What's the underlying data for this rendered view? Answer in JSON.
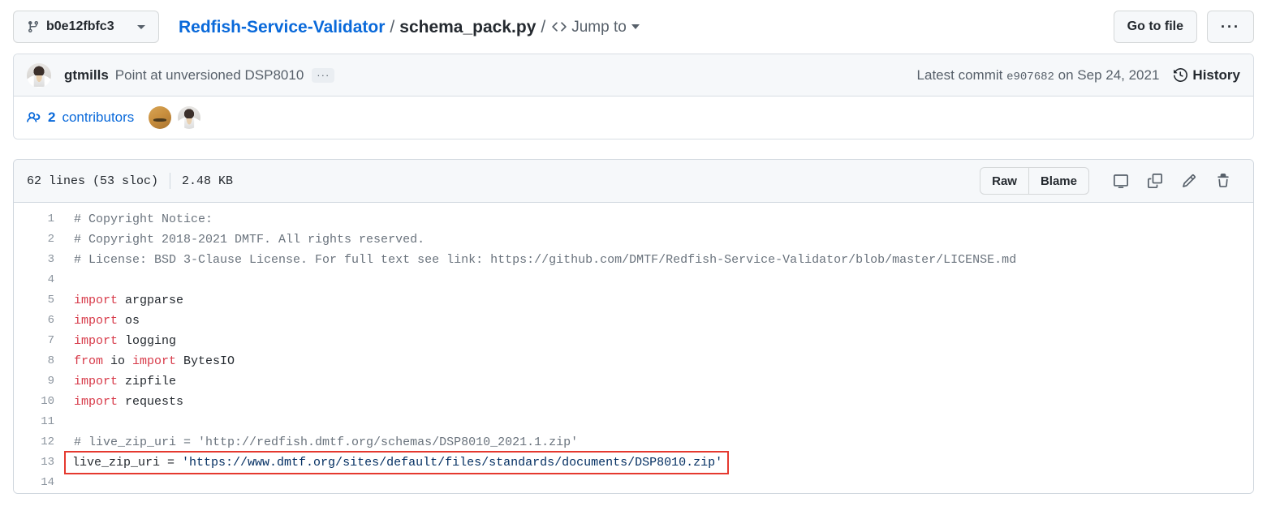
{
  "header": {
    "branch_label": "b0e12fbfc3",
    "branch_icon": "git-branch-icon",
    "repo_name": "Redfish-Service-Validator",
    "path_separator": "/",
    "file_name": "schema_pack.py",
    "jump_to_label": "Jump to",
    "jump_to_icon": "code-icon",
    "go_to_file_label": "Go to file",
    "more_options_label": "···"
  },
  "commit": {
    "author": "gtmills",
    "message": "Point at unversioned DSP8010",
    "expander_label": "···",
    "latest_commit_label": "Latest commit",
    "sha": "e907682",
    "date_label": "on Sep 24, 2021",
    "history_label": "History",
    "history_icon": "history-clock-icon",
    "contributors_count": "2",
    "contributors_label": "contributors",
    "contributors_icon": "people-icon",
    "avatars": [
      "sandy",
      "person"
    ]
  },
  "file_toolbar": {
    "lines_label": "62 lines (53 sloc)",
    "size_label": "2.48 KB",
    "raw_label": "Raw",
    "blame_label": "Blame",
    "icons": [
      "desktop-download-icon",
      "copy-icon",
      "pencil-edit-icon",
      "trash-delete-icon"
    ]
  },
  "annotation": {
    "color": "#e5392f",
    "target_line": 13
  },
  "code": {
    "language": "python",
    "lines": [
      {
        "n": "1",
        "tokens": [
          {
            "t": "# Copyright Notice:",
            "c": "cm"
          }
        ]
      },
      {
        "n": "2",
        "tokens": [
          {
            "t": "# Copyright 2018-2021 DMTF. All rights reserved.",
            "c": "cm"
          }
        ]
      },
      {
        "n": "3",
        "tokens": [
          {
            "t": "# License: BSD 3-Clause License. For full text see link: https://github.com/DMTF/Redfish-Service-Validator/blob/master/LICENSE.md",
            "c": "cm"
          }
        ]
      },
      {
        "n": "4",
        "tokens": []
      },
      {
        "n": "5",
        "tokens": [
          {
            "t": "import",
            "c": "kw"
          },
          {
            "t": " argparse",
            "c": "nm"
          }
        ]
      },
      {
        "n": "6",
        "tokens": [
          {
            "t": "import",
            "c": "kw"
          },
          {
            "t": " os",
            "c": "nm"
          }
        ]
      },
      {
        "n": "7",
        "tokens": [
          {
            "t": "import",
            "c": "kw"
          },
          {
            "t": " logging",
            "c": "nm"
          }
        ]
      },
      {
        "n": "8",
        "tokens": [
          {
            "t": "from",
            "c": "kw"
          },
          {
            "t": " io ",
            "c": "nm"
          },
          {
            "t": "import",
            "c": "kw"
          },
          {
            "t": " BytesIO",
            "c": "nm"
          }
        ]
      },
      {
        "n": "9",
        "tokens": [
          {
            "t": "import",
            "c": "kw"
          },
          {
            "t": " zipfile",
            "c": "nm"
          }
        ]
      },
      {
        "n": "10",
        "tokens": [
          {
            "t": "import",
            "c": "kw"
          },
          {
            "t": " requests",
            "c": "nm"
          }
        ]
      },
      {
        "n": "11",
        "tokens": []
      },
      {
        "n": "12",
        "tokens": [
          {
            "t": "# live_zip_uri = 'http://redfish.dmtf.org/schemas/DSP8010_2021.1.zip'",
            "c": "cm"
          }
        ]
      },
      {
        "n": "13",
        "tokens": [
          {
            "t": "live_zip_uri = ",
            "c": "nm"
          },
          {
            "t": "'https://www.dmtf.org/sites/default/files/standards/documents/DSP8010.zip'",
            "c": "st"
          }
        ],
        "annotated": true
      },
      {
        "n": "14",
        "tokens": []
      }
    ]
  }
}
